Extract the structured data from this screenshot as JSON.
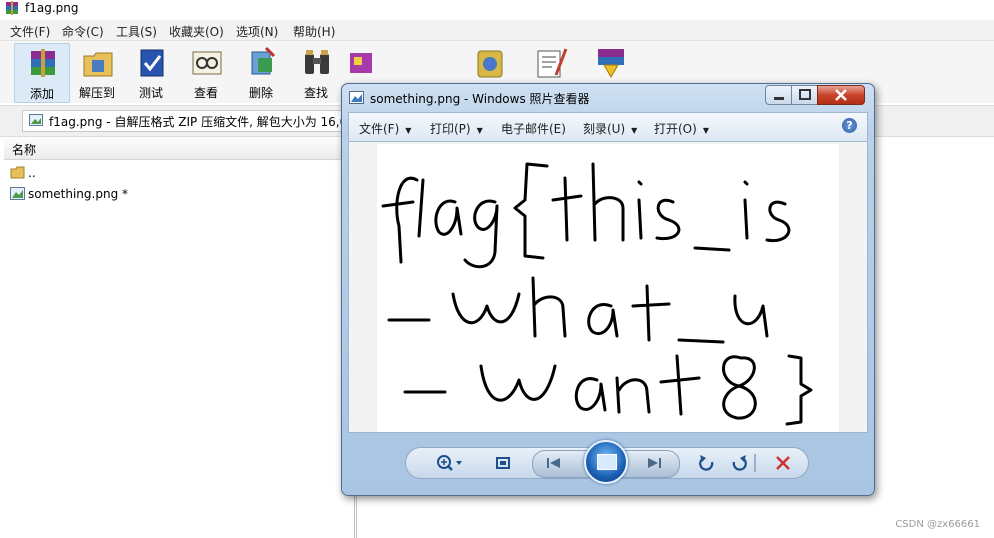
{
  "rar": {
    "title": "f1ag.png",
    "menu": [
      "文件(F)",
      "命令(C)",
      "工具(S)",
      "收藏夹(O)",
      "选项(N)",
      "帮助(H)"
    ],
    "toolbar": [
      "添加",
      "解压到",
      "测试",
      "查看",
      "删除",
      "查找"
    ],
    "path_text": "f1ag.png - 自解压格式 ZIP 压缩文件, 解包大小为 16,0",
    "list_header": "名称",
    "rows": [
      "..",
      "something.png *"
    ]
  },
  "viewer": {
    "title": "something.png - Windows 照片查看器",
    "menu": [
      "文件(F)",
      "打印(P)",
      "电子邮件(E)",
      "刻录(U)",
      "打开(O)"
    ],
    "help": "?",
    "image_lines": [
      "flag{this_is",
      "_what_u",
      "_want8}"
    ]
  },
  "watermark": "CSDN @zx66661",
  "icons": {
    "help": "help-icon",
    "zoom": "zoom-icon",
    "fit": "fit-window-icon",
    "prev": "previous-icon",
    "play": "slideshow-icon",
    "next": "next-icon",
    "rotate_ccw": "rotate-ccw-icon",
    "rotate_cw": "rotate-cw-icon",
    "delete": "delete-icon"
  },
  "colors": {
    "viewer_frame": "#b9d0e8",
    "accent": "#1d4f8c",
    "delete": "#d23030"
  }
}
